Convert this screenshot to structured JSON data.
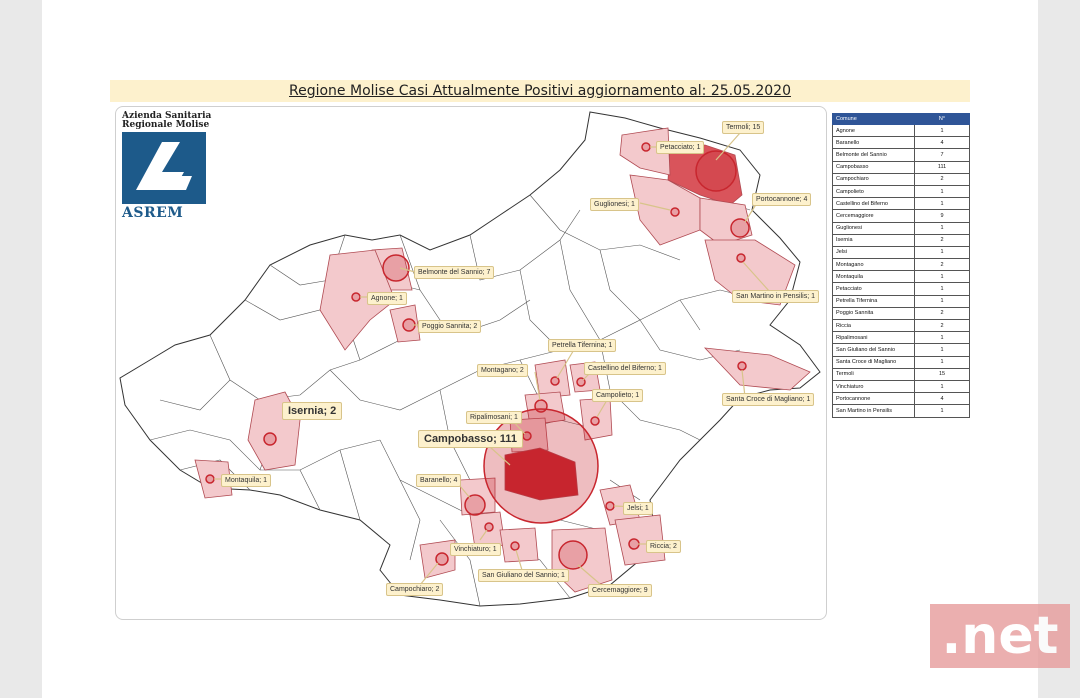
{
  "title": "Regione Molise Casi Attualmente Positivi aggiornamento al: 25.05.2020",
  "logo": {
    "line1": "Azienda Sanitaria",
    "line2": "Regionale Molise",
    "acronym": "ASREM"
  },
  "table": {
    "headers": [
      "Comune",
      "N°"
    ],
    "rows": [
      [
        "Agnone",
        "1"
      ],
      [
        "Baranello",
        "4"
      ],
      [
        "Belmonte del Sannio",
        "7"
      ],
      [
        "Campobasso",
        "111"
      ],
      [
        "Campochiaro",
        "2"
      ],
      [
        "Campolieto",
        "1"
      ],
      [
        "Castellino del Biferno",
        "1"
      ],
      [
        "Cercemaggiore",
        "9"
      ],
      [
        "Guglionesi",
        "1"
      ],
      [
        "Isernia",
        "2"
      ],
      [
        "Jelsi",
        "1"
      ],
      [
        "Montagano",
        "2"
      ],
      [
        "Montaquila",
        "1"
      ],
      [
        "Petacciato",
        "1"
      ],
      [
        "Petrella Tifernina",
        "1"
      ],
      [
        "Poggio Sannita",
        "2"
      ],
      [
        "Riccia",
        "2"
      ],
      [
        "Ripalimosani",
        "1"
      ],
      [
        "San Giuliano del Sannio",
        "1"
      ],
      [
        "Santa Croce di Magliano",
        "1"
      ],
      [
        "Termoli",
        "15"
      ],
      [
        "Vinchiaturo",
        "1"
      ],
      [
        "Portocannone",
        "4"
      ],
      [
        "San Martino in Pensilis",
        "1"
      ]
    ]
  },
  "callouts": {
    "termoli": "Termoli; 15",
    "petacciato": "Petacciato; 1",
    "guglionesi": "Guglionesi; 1",
    "portocannone": "Portocannone; 4",
    "sanmartino": "San Martino in Pensilis; 1",
    "belmonte": "Belmonte del Sannio; 7",
    "agnone": "Agnone; 1",
    "poggio": "Poggio Sannita; 2",
    "petrella": "Petrella Tifernina; 1",
    "montagano": "Montagano; 2",
    "castellino": "Castellino del Biferno; 1",
    "santacroce": "Santa Croce di Magliano; 1",
    "campolieto": "Campolieto; 1",
    "ripalimosani": "Ripalimosani; 1",
    "isernia": "Isernia; 2",
    "campobasso": "Campobasso; 111",
    "montaquila": "Montaquila; 1",
    "baranello": "Baranello; 4",
    "jelsi": "Jelsi; 1",
    "riccia": "Riccia; 2",
    "vinchiaturo": "Vinchiaturo; 1",
    "campochiaro": "Campochiaro; 2",
    "sangiuliano": "San Giuliano del Sannio; 1",
    "cercemaggiore": "Cercemaggiore; 9"
  },
  "watermark": ".net",
  "colors": {
    "highlight": "#f3c9cc",
    "bubble": "#c8262e",
    "label_bg": "#fdf1cd",
    "table_header": "#2f5597"
  }
}
